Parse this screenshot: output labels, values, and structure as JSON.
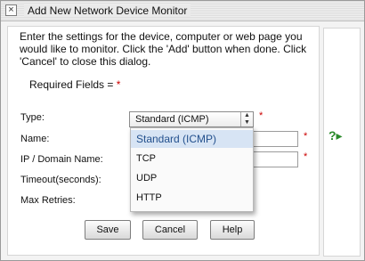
{
  "window": {
    "title": "Add New Network Device Monitor",
    "close_glyph": "×"
  },
  "intro_text": "Enter the settings for the device, computer or web page you would like to monitor. Click the 'Add' button when done. Click 'Cancel' to close this dialog.",
  "required_label": "Required Fields =",
  "required_marker": "*",
  "form": {
    "type_label": "Type:",
    "name_label": "Name:",
    "ip_label": "IP / Domain Name:",
    "timeout_label": "Timeout(seconds):",
    "retries_label": "Max Retries:",
    "type_selected": "Standard (ICMP)",
    "type_options": [
      "Standard (ICMP)",
      "TCP",
      "UDP",
      "HTTP"
    ]
  },
  "buttons": {
    "save": "Save",
    "cancel": "Cancel",
    "help": "Help"
  },
  "help_panel": {
    "glyph": "?▸",
    "icon": "help-expand-icon"
  },
  "colors": {
    "required": "#cc0000",
    "selected_option_bg": "#d7e4f4",
    "selected_option_text": "#23508d",
    "help_icon": "#2a8a2a"
  }
}
